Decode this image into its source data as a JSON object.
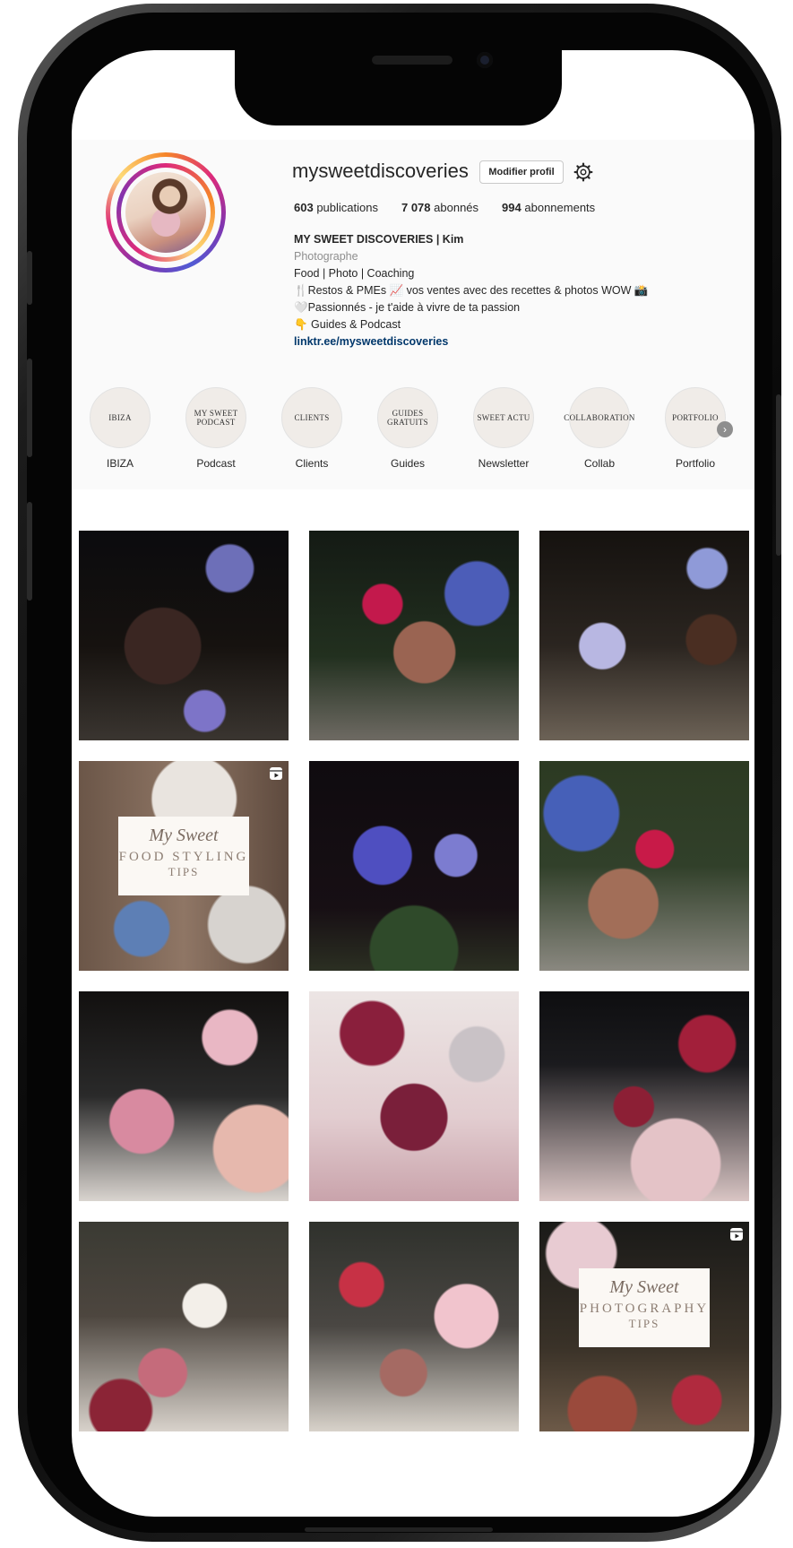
{
  "profile": {
    "username": "mysweetdiscoveries",
    "edit_button": "Modifier profil",
    "stats": {
      "posts_count": "603",
      "posts_label": "publications",
      "followers_count": "7 078",
      "followers_label": "abonnés",
      "following_count": "994",
      "following_label": "abonnements"
    },
    "bio": {
      "name": "MY SWEET DISCOVERIES | Kim",
      "category": "Photographe",
      "line1": "Food | Photo | Coaching",
      "line2": "🍴Restos & PMEs 📈 vos ventes avec des recettes & photos WOW 📸",
      "line3": "🤍Passionnés - je t'aide à vivre de ta passion",
      "line4": "👇 Guides & Podcast",
      "link": "linktr.ee/mysweetdiscoveries"
    }
  },
  "highlights": [
    {
      "cover": "IBIZA",
      "label": "IBIZA"
    },
    {
      "cover": "MY SWEET PODCAST",
      "label": "Podcast"
    },
    {
      "cover": "CLIENTS",
      "label": "Clients"
    },
    {
      "cover": "GUIDES GRATUITS",
      "label": "Guides"
    },
    {
      "cover": "SWEET ACTU",
      "label": "Newsletter"
    },
    {
      "cover": "COLLABORATION",
      "label": "Collab"
    },
    {
      "cover": "PORTFOLIO",
      "label": "Portfolio"
    }
  ],
  "posts": [
    {
      "overlay": null
    },
    {
      "overlay": null
    },
    {
      "overlay": null
    },
    {
      "overlay": {
        "script": "My Sweet",
        "big": "FOOD STYLING",
        "small": "TIPS"
      }
    },
    {
      "overlay": null
    },
    {
      "overlay": null
    },
    {
      "overlay": null
    },
    {
      "overlay": null
    },
    {
      "overlay": null
    },
    {
      "overlay": null
    },
    {
      "overlay": null
    },
    {
      "overlay": {
        "script": "My Sweet",
        "big": "PHOTOGRAPHY",
        "small": "TIPS"
      }
    }
  ],
  "icons": {
    "settings": "gear-icon",
    "highlights_next": "chevron-right-icon",
    "reel_badge": "reel-icon"
  },
  "colors": {
    "link": "#00376b",
    "story_ring": "#dd2a7b"
  }
}
